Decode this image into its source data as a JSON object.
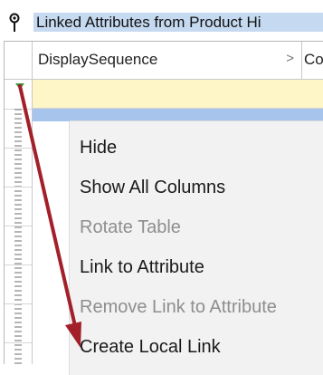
{
  "panel": {
    "title": "Linked Attributes from Product Hi",
    "columns": [
      {
        "label": "DisplaySequence"
      },
      {
        "label": "Co"
      }
    ]
  },
  "context_menu": {
    "items": [
      {
        "label": "Hide",
        "enabled": true
      },
      {
        "label": "Show All Columns",
        "enabled": true
      },
      {
        "label": "Rotate Table",
        "enabled": false
      },
      {
        "label": "Link to Attribute",
        "enabled": true
      },
      {
        "label": "Remove Link to Attribute",
        "enabled": false
      },
      {
        "label": "Create Local Link",
        "enabled": true
      }
    ]
  },
  "colors": {
    "title_highlight": "#c5d9f0",
    "new_row": "#fff6c8",
    "selected_row": "#a7c4ec",
    "annotation_arrow": "#a3202b"
  }
}
